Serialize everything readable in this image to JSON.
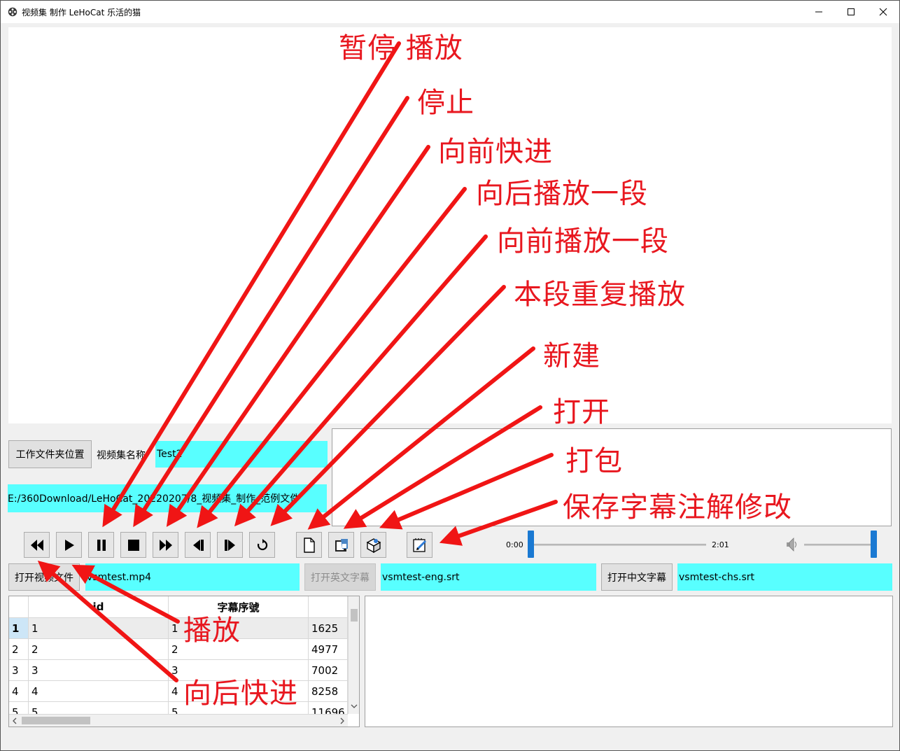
{
  "window": {
    "title": "视频集 制作  LeHoCat 乐活的猫",
    "minimize_icon": "minimize-icon",
    "maximize_icon": "maximize-icon",
    "close_icon": "close-icon"
  },
  "form": {
    "workdir_button": "工作文件夹位置",
    "set_name_label": "视频集名称",
    "set_name_value": "Test2",
    "workdir_path": "E:/360Download/LeHoCat_20220207/8_视频集_制作_范例文件",
    "open_video_button": "打开视频文件",
    "video_file": "vsmtest.mp4",
    "open_eng_sub_button": "打开英文字幕",
    "eng_sub_file": "vsmtest-eng.srt",
    "open_chs_sub_button": "打开中文字幕",
    "chs_sub_file": "vsmtest-chs.srt"
  },
  "toolbar": {
    "buttons": [
      "rewind-icon",
      "play-icon",
      "pause-icon",
      "stop-icon",
      "fast-forward-icon",
      "step-back-icon",
      "step-forward-icon",
      "repeat-icon",
      "new-file-icon",
      "open-icon",
      "package-icon",
      "save-edit-icon"
    ]
  },
  "player": {
    "time_start": "0:00",
    "time_end": "2:01",
    "progress": 0.0,
    "volume": 1.0,
    "volume_icon": "speaker-icon"
  },
  "table": {
    "columns": [
      "id",
      "字幕序號",
      ""
    ],
    "rows": [
      {
        "num": "1",
        "id": "1",
        "seq": "1",
        "time": "1625"
      },
      {
        "num": "2",
        "id": "2",
        "seq": "2",
        "time": "4977"
      },
      {
        "num": "3",
        "id": "3",
        "seq": "3",
        "time": "7002"
      },
      {
        "num": "4",
        "id": "4",
        "seq": "4",
        "time": "8258"
      },
      {
        "num": "5",
        "id": "5",
        "seq": "5",
        "time": "11696"
      }
    ]
  },
  "annotations": {
    "pause_play": "暂停 播放",
    "stop": "停止",
    "fast_forward": "向前快进",
    "play_back_segment": "向后播放一段",
    "play_forward_segment": "向前播放一段",
    "repeat_segment": "本段重复播放",
    "new": "新建",
    "open": "打开",
    "package": "打包",
    "save_edits": "保存字幕注解修改",
    "play": "播放",
    "rewind": "向后快进"
  },
  "colors": {
    "field_cyan": "#58ffff",
    "annotation_red": "#e8171f",
    "slider_blue": "#1a79d2"
  }
}
